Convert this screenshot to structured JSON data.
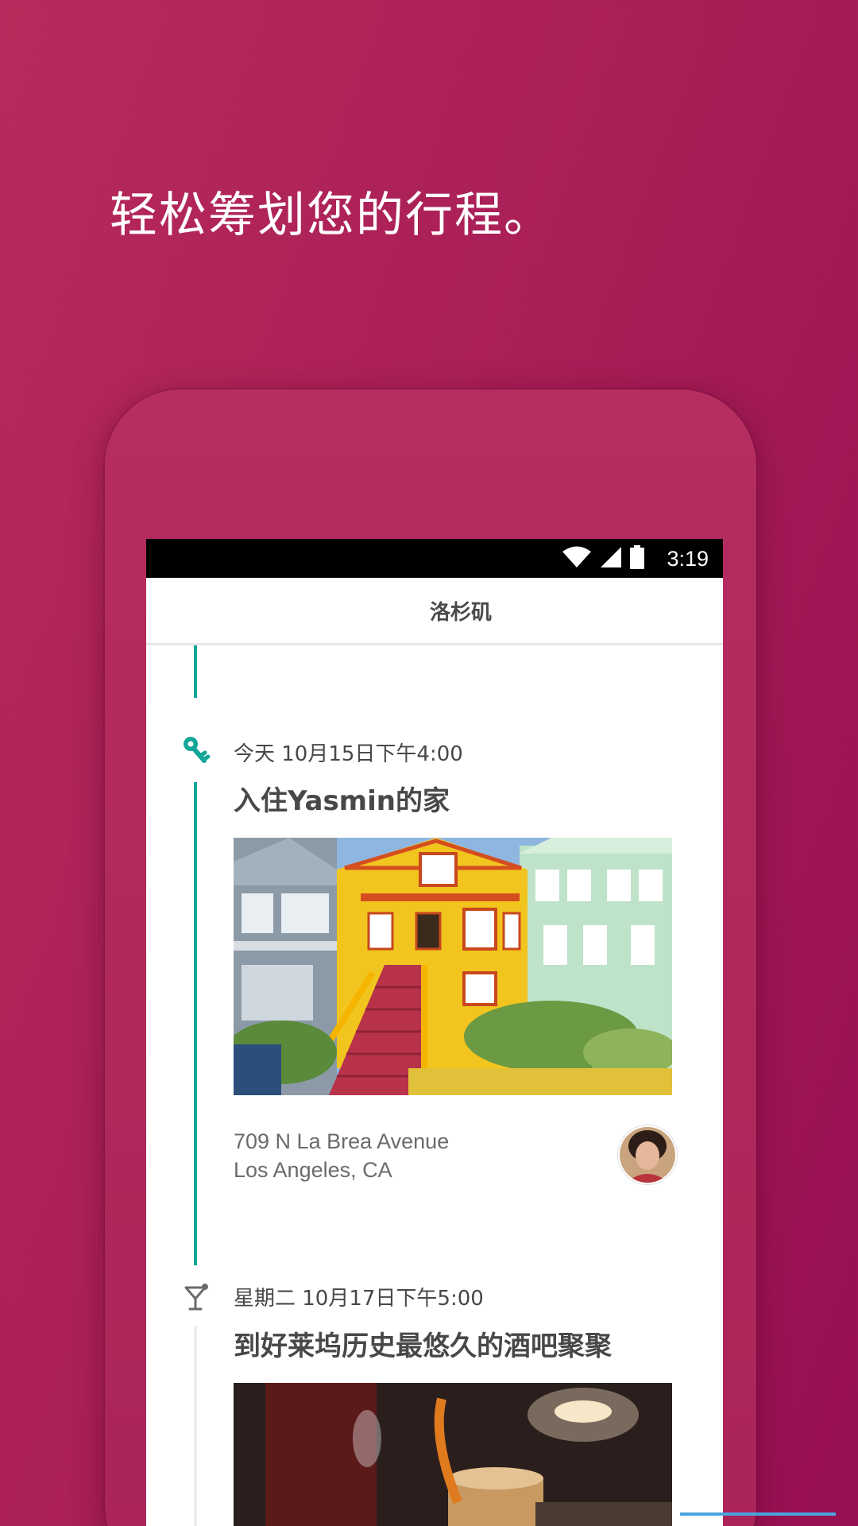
{
  "headline": "轻松筹划您的行程。",
  "status_bar": {
    "time": "3:19",
    "icons": [
      "wifi-icon",
      "cell-signal-icon",
      "battery-icon"
    ]
  },
  "app_bar": {
    "title": "洛杉矶"
  },
  "events": [
    {
      "icon": "key-icon",
      "time": "今天 10月15日下午4:00",
      "title": "入住Yasmin的家",
      "address_line1": "709 N La Brea Avenue",
      "address_line2": "Los Angeles, CA",
      "photo": "house-photo",
      "avatar": "host-avatar"
    },
    {
      "icon": "cocktail-icon",
      "time": "星期二 10月17日下午5:00",
      "title": "到好莱坞历史最悠久的酒吧聚聚",
      "photo": "cocktail-photo"
    }
  ],
  "colors": {
    "background": "#a91f57",
    "timeline_accent": "#14a699",
    "text_dark": "#484848"
  }
}
